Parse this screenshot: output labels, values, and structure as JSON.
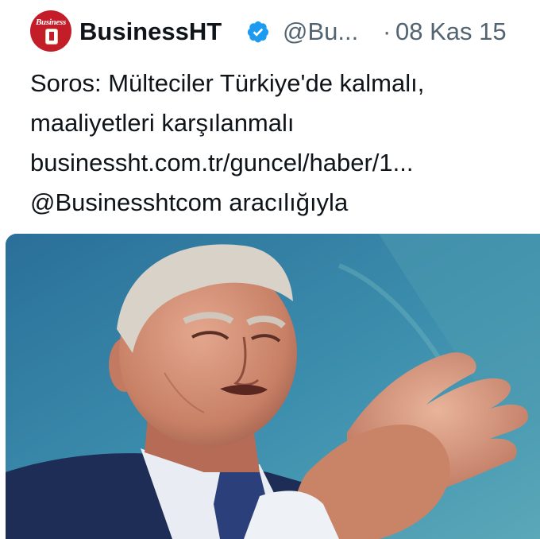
{
  "tweet": {
    "avatar": {
      "brand": "Business"
    },
    "author_name": "BusinessHT",
    "handle": "@Bu...",
    "separator": "·",
    "date": "08 Kas 15",
    "text_lines": [
      "Soros: Mülteciler Türkiye'de kalmalı,",
      "maaliyetleri karşılanmalı",
      "businessht.com.tr/guncel/haber/1...",
      "@Businesshtcom aracılığıyla"
    ]
  },
  "colors": {
    "verified": "#1d9bf0",
    "secondary_text": "#536471",
    "primary_text": "#0f1419",
    "brand_red": "#c41d2a"
  },
  "icons": [
    "verified-badge-icon"
  ]
}
